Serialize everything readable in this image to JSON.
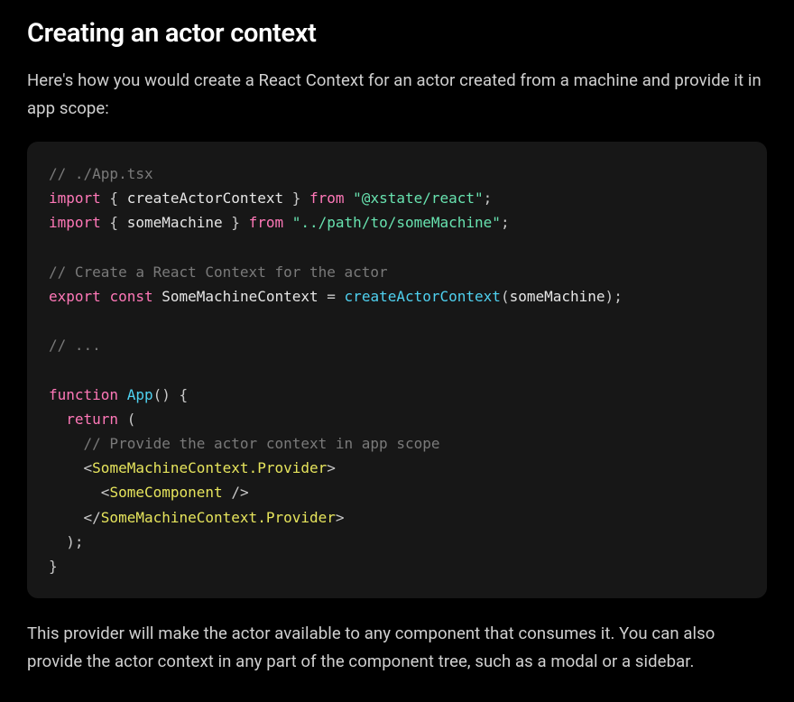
{
  "heading": "Creating an actor context",
  "intro": "Here's how you would create a React Context for an actor created from a machine and provide it in app scope:",
  "outro": "This provider will make the actor available to any component that consumes it. You can also provide the actor context in any part of the component tree, such as a modal or a sidebar.",
  "code": {
    "c1": "// ./App.tsx",
    "l2_import": "import",
    "l2_brace_open": " { ",
    "l2_ident": "createActorContext",
    "l2_brace_close": " } ",
    "l2_from": "from",
    "l2_sp": " ",
    "l2_str": "\"@xstate/react\"",
    "l2_semi": ";",
    "l3_import": "import",
    "l3_brace_open": " { ",
    "l3_ident": "someMachine",
    "l3_brace_close": " } ",
    "l3_from": "from",
    "l3_sp": " ",
    "l3_str": "\"../path/to/someMachine\"",
    "l3_semi": ";",
    "c2": "// Create a React Context for the actor",
    "l5_export": "export",
    "l5_sp1": " ",
    "l5_const": "const",
    "l5_sp2": " ",
    "l5_name": "SomeMachineContext",
    "l5_eq": " = ",
    "l5_fn": "createActorContext",
    "l5_po": "(",
    "l5_arg": "someMachine",
    "l5_pc": ")",
    "l5_semi": ";",
    "c3": "// ...",
    "l7_fn": "function",
    "l7_sp": " ",
    "l7_name": "App",
    "l7_po": "(",
    "l7_pc": ")",
    "l7_sp2": " ",
    "l7_brace": "{",
    "l8_indent": "  ",
    "l8_return": "return",
    "l8_sp": " ",
    "l8_po": "(",
    "l9_indent": "    ",
    "c4": "// Provide the actor context in app scope",
    "l10_indent": "    ",
    "l10_lt": "<",
    "l10_tag": "SomeMachineContext.Provider",
    "l10_gt": ">",
    "l11_indent": "      ",
    "l11_lt": "<",
    "l11_tag": "SomeComponent",
    "l11_sp": " ",
    "l11_slash": "/>",
    "l12_indent": "    ",
    "l12_lt": "</",
    "l12_tag": "SomeMachineContext.Provider",
    "l12_gt": ">",
    "l13_indent": "  ",
    "l13_pc": ")",
    "l13_semi": ";",
    "l14_brace": "}"
  }
}
